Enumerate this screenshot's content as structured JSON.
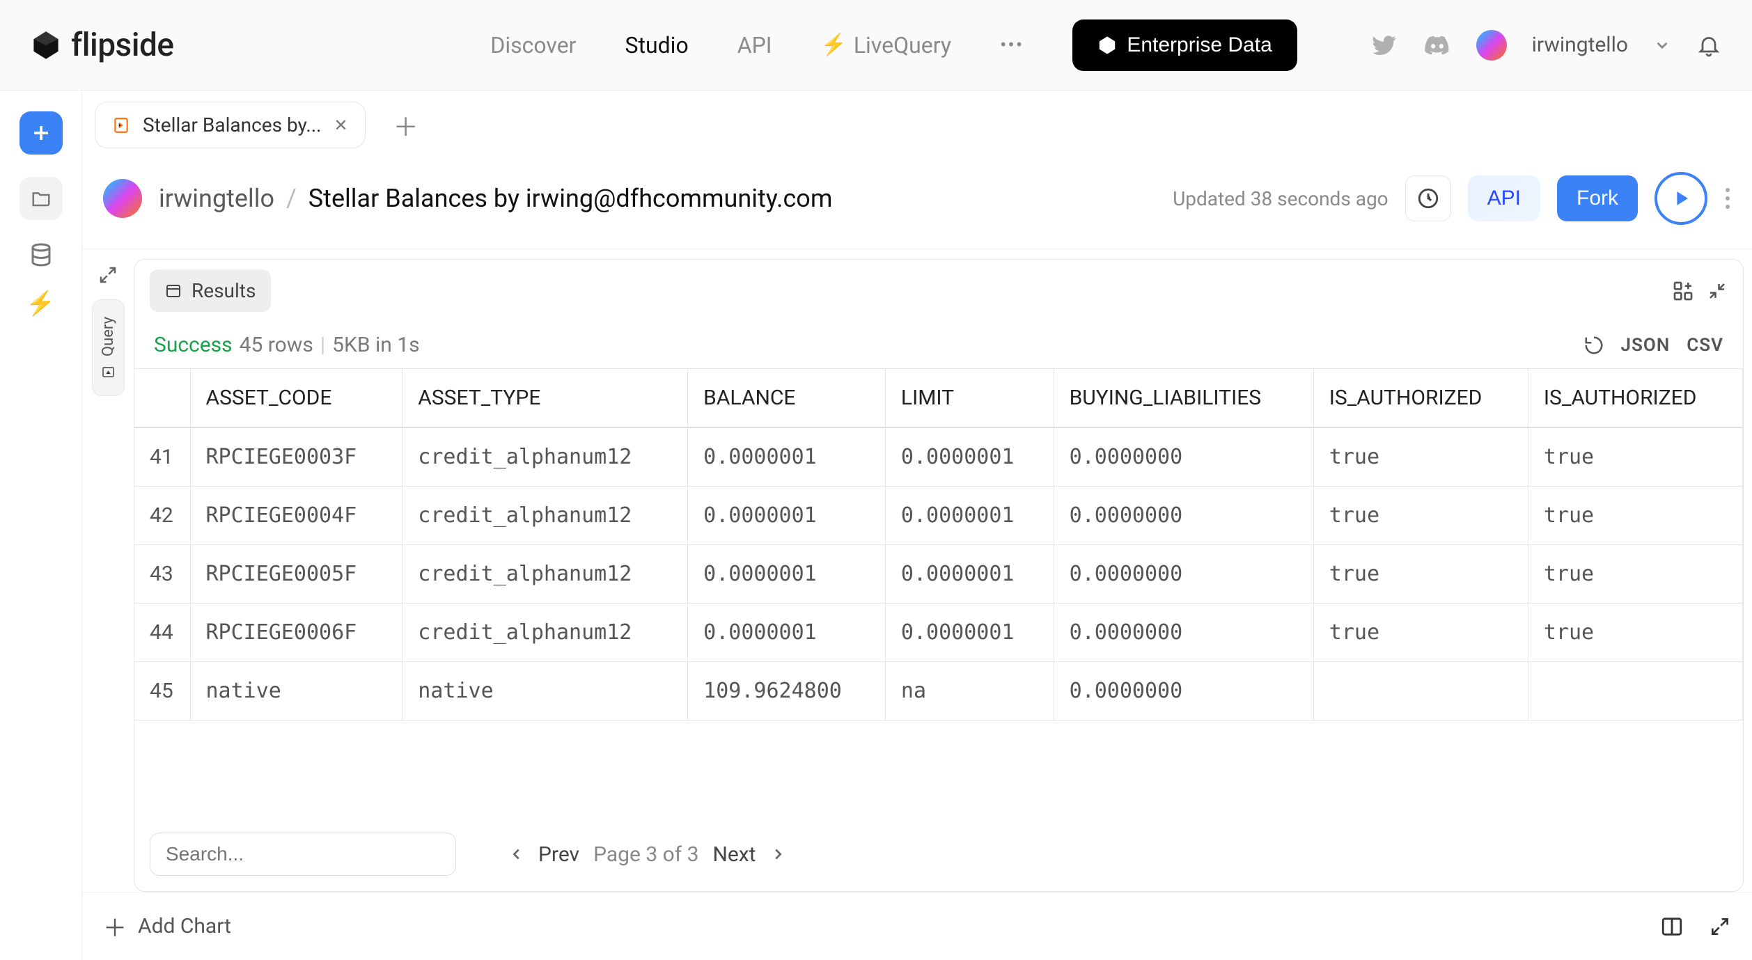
{
  "brand": "flipside",
  "nav": {
    "discover": "Discover",
    "studio": "Studio",
    "api": "API",
    "livequery": "LiveQuery",
    "enterprise": "Enterprise Data"
  },
  "user": {
    "name": "irwingtello"
  },
  "tab": {
    "label": "Stellar Balances by..."
  },
  "breadcrumb": {
    "owner": "irwingtello",
    "title": "Stellar Balances by irwing@dfhcommunity.com"
  },
  "updated": "Updated 38 seconds ago",
  "actions": {
    "api": "API",
    "fork": "Fork"
  },
  "sidebarQuery": "Query",
  "resultsTab": "Results",
  "status": {
    "ok": "Success",
    "rows": "45 rows",
    "size": "5KB in 1s"
  },
  "export": {
    "json": "JSON",
    "csv": "CSV"
  },
  "columns": [
    "ASSET_CODE",
    "ASSET_TYPE",
    "BALANCE",
    "LIMIT",
    "BUYING_LIABILITIES",
    "IS_AUTHORIZED",
    "IS_AUTHORIZED"
  ],
  "rows": [
    {
      "n": "41",
      "cells": [
        "RPCIEGE0003F",
        "credit_alphanum12",
        "0.0000001",
        "0.0000001",
        "0.0000000",
        "true",
        "true"
      ]
    },
    {
      "n": "42",
      "cells": [
        "RPCIEGE0004F",
        "credit_alphanum12",
        "0.0000001",
        "0.0000001",
        "0.0000000",
        "true",
        "true"
      ]
    },
    {
      "n": "43",
      "cells": [
        "RPCIEGE0005F",
        "credit_alphanum12",
        "0.0000001",
        "0.0000001",
        "0.0000000",
        "true",
        "true"
      ]
    },
    {
      "n": "44",
      "cells": [
        "RPCIEGE0006F",
        "credit_alphanum12",
        "0.0000001",
        "0.0000001",
        "0.0000000",
        "true",
        "true"
      ]
    },
    {
      "n": "45",
      "cells": [
        "native",
        "native",
        "109.9624800",
        "na",
        "0.0000000",
        "",
        ""
      ]
    }
  ],
  "pager": {
    "search_placeholder": "Search...",
    "prev": "Prev",
    "page": "Page 3 of 3",
    "next": "Next"
  },
  "footer": {
    "add_chart": "Add Chart"
  }
}
